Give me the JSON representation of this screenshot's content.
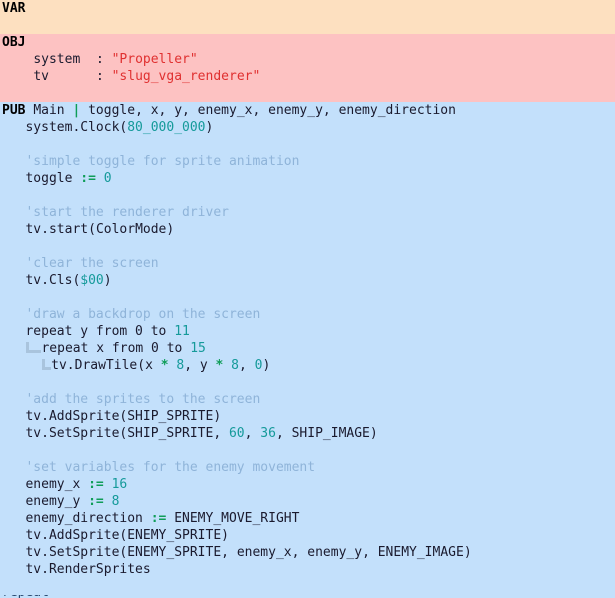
{
  "editor": {
    "language": "Propeller Spin",
    "colors": {
      "var_block_bg": "#fde0c0",
      "obj_block_bg": "#fdc2c2",
      "pub_block_bg": "#c3e0fb",
      "keyword": "#000000",
      "number": "#159a9a",
      "operator": "#0f9d58",
      "comment": "#8fb4d9",
      "string": "#e03030",
      "identifier": "#1a1a2e",
      "indent_guide": "#a9c4dd"
    }
  },
  "blocks": {
    "var": {
      "keyword": "VAR",
      "lines": [
        ""
      ]
    },
    "obj": {
      "keyword": "OBJ",
      "entries": [
        {
          "name": "system",
          "pad": "  ",
          "colon": ":",
          "value": "\"Propeller\""
        },
        {
          "name": "tv",
          "pad": "      ",
          "colon": ":",
          "value": "\"slug_vga_renderer\""
        }
      ]
    },
    "pub": {
      "keyword": "PUB",
      "method": "Main",
      "pipe": "|",
      "params": "toggle, x, y, enemy_x, enemy_y, enemy_direction",
      "code": {
        "clock_call": "system.Clock",
        "clock_arg": "80_000_000",
        "c1": "'simple toggle for sprite animation",
        "toggle_var": "toggle",
        "assign": ":=",
        "toggle_val": "0",
        "c2": "'start the renderer driver",
        "tv_start": "tv.start",
        "tv_start_arg": "ColorMode",
        "c3": "'clear the screen",
        "tv_cls": "tv.Cls",
        "tv_cls_arg": "$00",
        "c4": "'draw a backdrop on the screen",
        "repeat_y": "repeat y from 0 to",
        "repeat_y_end": "11",
        "repeat_x": "repeat x from 0 to",
        "repeat_x_end": "15",
        "drawtile": "tv.DrawTile",
        "drawtile_x": "x",
        "drawtile_mul": "*",
        "drawtile_8a": "8",
        "drawtile_y": "y",
        "drawtile_8b": "8",
        "drawtile_0": "0",
        "c5": "'add the sprites to the screen",
        "add_ship": "tv.AddSprite",
        "add_ship_arg": "SHIP_SPRITE",
        "set_ship": "tv.SetSprite",
        "set_ship_a": "SHIP_SPRITE",
        "set_ship_b": "60",
        "set_ship_c": "36",
        "set_ship_d": "SHIP_IMAGE",
        "c6": "'set variables for the enemy movement",
        "enemy_x_var": "enemy_x",
        "enemy_x_val": "16",
        "enemy_y_var": "enemy_y",
        "enemy_y_val": "8",
        "enemy_dir_var": "enemy_direction",
        "enemy_dir_val": "ENEMY_MOVE_RIGHT",
        "add_enemy": "tv.AddSprite",
        "add_enemy_arg": "ENEMY_SPRITE",
        "set_enemy": "tv.SetSprite",
        "set_enemy_a": "ENEMY_SPRITE",
        "set_enemy_b": "enemy_x",
        "set_enemy_c": "enemy_y",
        "set_enemy_d": "ENEMY_IMAGE",
        "render": "tv.RenderSprites",
        "clipped_next": "repeat"
      }
    }
  }
}
